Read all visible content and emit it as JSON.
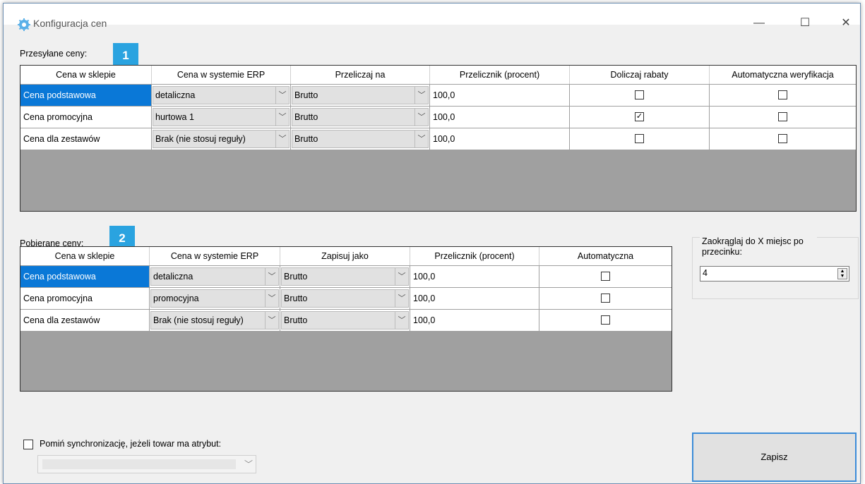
{
  "window": {
    "title": "Konfiguracja cen",
    "icon": "gear-app-icon",
    "controls": {
      "minimize": "—",
      "maximize": "☐",
      "close": "✕"
    }
  },
  "sent": {
    "label": "Przesyłane ceny:",
    "badge": "1",
    "columns": [
      "Cena w sklepie",
      "Cena w systemie ERP",
      "Przeliczaj na",
      "Przelicznik (procent)",
      "Doliczaj rabaty",
      "Automatyczna weryfikacja"
    ],
    "rows": [
      {
        "shop": "Cena podstawowa",
        "erp": "detaliczna",
        "convert": "Brutto",
        "factor": "100,0",
        "discounts": false,
        "auto": false,
        "selected": true
      },
      {
        "shop": "Cena promocyjna",
        "erp": "hurtowa 1",
        "convert": "Brutto",
        "factor": "100,0",
        "discounts": true,
        "auto": false,
        "selected": false
      },
      {
        "shop": "Cena dla zestawów",
        "erp": "Brak (nie stosuj reguły)",
        "convert": "Brutto",
        "factor": "100,0",
        "discounts": false,
        "auto": false,
        "selected": false
      }
    ]
  },
  "fetched": {
    "label": "Pobierane ceny:",
    "badge": "2",
    "columns": [
      "Cena w sklepie",
      "Cena w systemie ERP",
      "Zapisuj jako",
      "Przelicznik (procent)",
      "Automatyczna"
    ],
    "rows": [
      {
        "shop": "Cena podstawowa",
        "erp": "detaliczna",
        "save_as": "Brutto",
        "factor": "100,0",
        "auto": false,
        "selected": true
      },
      {
        "shop": "Cena promocyjna",
        "erp": "promocyjna",
        "save_as": "Brutto",
        "factor": "100,0",
        "auto": false,
        "selected": false
      },
      {
        "shop": "Cena dla zestawów",
        "erp": "Brak (nie stosuj reguły)",
        "save_as": "Brutto",
        "factor": "100,0",
        "auto": false,
        "selected": false
      }
    ]
  },
  "rounding": {
    "label": "Zaokrąglaj do X miejsc po przecinku:",
    "value": "4"
  },
  "skip_sync": {
    "label": "Pomiń synchronizację, jeżeli towar ma atrybut:",
    "checked": false,
    "attribute": ""
  },
  "save_button": "Zapisz",
  "colors": {
    "selection": "#0a78d7",
    "badge": "#2aa3e0",
    "grid_empty": "#a0a0a0",
    "button_border": "#3c8cd8"
  }
}
